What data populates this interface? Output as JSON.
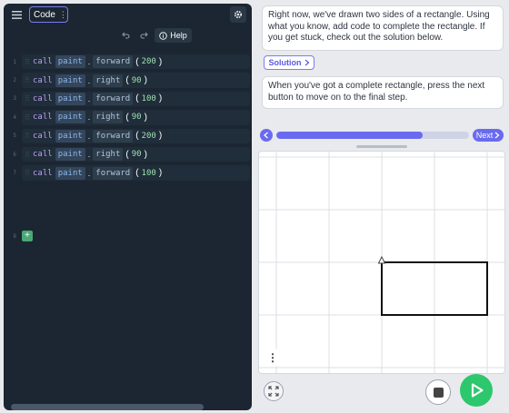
{
  "editor": {
    "tab_label": "Code",
    "help_label": "Help",
    "line_numbers": [
      "1",
      "2",
      "3",
      "4",
      "5",
      "6",
      "7",
      "8"
    ],
    "lines": [
      {
        "kw": "call",
        "obj": "paint",
        "method": "forward",
        "arg": "200"
      },
      {
        "kw": "call",
        "obj": "paint",
        "method": "right",
        "arg": "90"
      },
      {
        "kw": "call",
        "obj": "paint",
        "method": "forward",
        "arg": "100"
      },
      {
        "kw": "call",
        "obj": "paint",
        "method": "right",
        "arg": "90"
      },
      {
        "kw": "call",
        "obj": "paint",
        "method": "forward",
        "arg": "200"
      },
      {
        "kw": "call",
        "obj": "paint",
        "method": "right",
        "arg": "90"
      },
      {
        "kw": "call",
        "obj": "paint",
        "method": "forward",
        "arg": "100"
      }
    ],
    "add_symbol": "+"
  },
  "instructions": {
    "text1": "Right now, we've drawn two sides of a rectangle. Using what you know, add code to complete the rectangle. If you get stuck, check out the solution below.",
    "solution_label": "Solution",
    "text2": "When you've got a complete rectangle, press the next button to move on to the final step."
  },
  "progress": {
    "value": 0.76,
    "next_label": "Next"
  },
  "canvas_menu_symbol": "⋮",
  "colors": {
    "editor_bg": "#1b2632",
    "accent": "#6a6af0",
    "run": "#2dc76d"
  }
}
